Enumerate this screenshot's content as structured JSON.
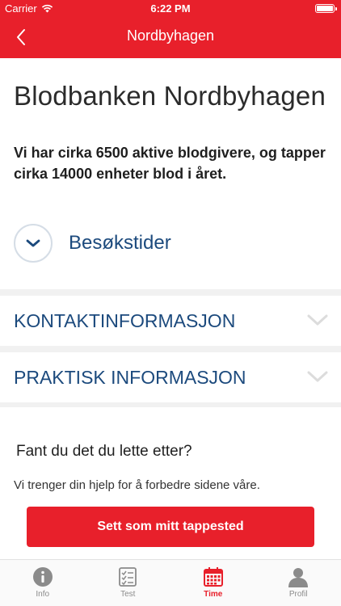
{
  "status_bar": {
    "carrier": "Carrier",
    "time": "6:22 PM"
  },
  "nav": {
    "title": "Nordbyhagen"
  },
  "page": {
    "title": "Blodbanken Nordbyhagen",
    "intro": "Vi har cirka 6500 aktive blodgivere, og tapper cirka 14000 enheter blod i året.",
    "visit_label": "Besøkstider"
  },
  "accordions": [
    {
      "label": "KONTAKTINFORMASJON"
    },
    {
      "label": "PRAKTISK INFORMASJON"
    }
  ],
  "feedback": {
    "title": "Fant du det du lette etter?",
    "text": "Vi trenger din hjelp for å forbedre sidene våre."
  },
  "button": {
    "label": "Sett som mitt tappested"
  },
  "tabs": [
    {
      "label": "Info",
      "icon": "info-icon"
    },
    {
      "label": "Test",
      "icon": "checklist-icon"
    },
    {
      "label": "Time",
      "icon": "calendar-icon",
      "active": true
    },
    {
      "label": "Profil",
      "icon": "profile-icon"
    }
  ],
  "colors": {
    "brand_red": "#e8202b",
    "link_blue": "#1c4a7d",
    "inactive_gray": "#8b8b8b"
  }
}
